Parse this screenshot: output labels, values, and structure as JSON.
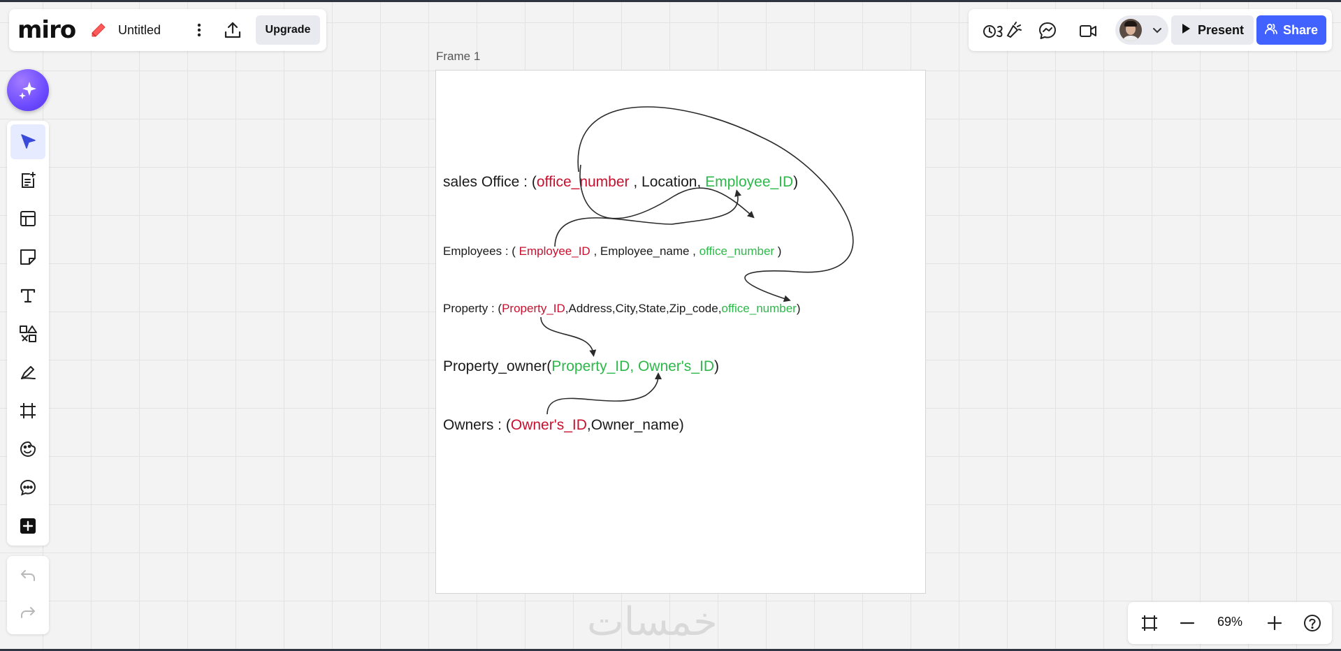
{
  "app": {
    "logo": "miro",
    "board_name": "Untitled"
  },
  "toolbar": {
    "upgrade_label": "Upgrade",
    "present_label": "Present",
    "share_label": "Share"
  },
  "frame": {
    "title": "Frame 1"
  },
  "schema": {
    "line1": {
      "prefix": "sales Office : (",
      "k1": "office_number",
      "mid": " , Location, ",
      "k2": "Employee_ID",
      "suffix": ")"
    },
    "line2": {
      "prefix": "Employees : ( ",
      "k1": "Employee_ID",
      "mid": " , Employee_name , ",
      "k2": "office_number",
      "suffix": " )"
    },
    "line3": {
      "prefix": "Property : (",
      "k1": "Property_ID",
      "mid": ",Address,City,State,Zip_code,",
      "k2": "office_number",
      "suffix": ")"
    },
    "line4": {
      "prefix": "Property_owner(",
      "k1": "Property_ID, Owner's_ID",
      "suffix": ")"
    },
    "line5": {
      "prefix": "Owners : (",
      "k1": "Owner's_ID",
      "mid": ",Owner_name)"
    }
  },
  "watermark": "خمسات",
  "zoom": {
    "level": "69%"
  },
  "colors": {
    "primary_key": "#c8102e",
    "foreign_key": "#2db84a",
    "accent": "#4262ff"
  },
  "icons": [
    "pencil-icon",
    "more-icon",
    "export-icon",
    "reactions-icon",
    "chat-icon",
    "video-icon",
    "present-play-icon",
    "share-people-icon",
    "ai-sparkle-icon",
    "select-cursor-icon",
    "notes-icon",
    "templates-icon",
    "sticky-note-icon",
    "text-icon",
    "shapes-icon",
    "pen-icon",
    "frame-icon",
    "sticker-icon",
    "comment-icon",
    "more-tools-icon",
    "undo-icon",
    "redo-icon",
    "fit-frame-icon",
    "zoom-out-icon",
    "zoom-in-icon",
    "help-icon"
  ]
}
